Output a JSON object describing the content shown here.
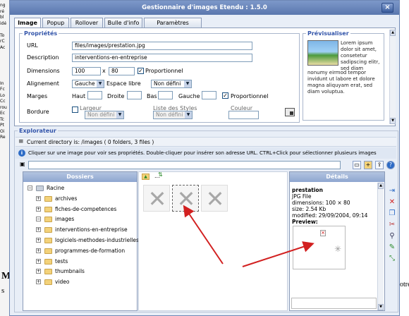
{
  "background": {
    "left_strip": [
      "ng",
      "ré",
      "bl",
      "idé",
      "",
      "To",
      "rC",
      "Ac",
      "",
      "",
      "",
      "",
      "",
      "In",
      "Fc",
      "Lo",
      "Cc",
      "rou",
      "Ec",
      "Tc",
      "Pt",
      "Oi",
      "Re"
    ],
    "text_M": "M",
    "text_s": "s",
    "text_otr": "otre"
  },
  "window": {
    "title": "Gestionnaire d'images Etendu : 1.5.0",
    "close_label": "×"
  },
  "tabs": [
    {
      "label": "Image",
      "active": true
    },
    {
      "label": "Popup"
    },
    {
      "label": "Rollover"
    },
    {
      "label": "Bulle d'info"
    },
    {
      "label": "Paramètres Avancés"
    }
  ],
  "props": {
    "legend": "Propriétés",
    "url_label": "URL",
    "url_value": "files/images/prestation.jpg",
    "description_label": "Description",
    "description_value": "interventions-en-entreprise",
    "dimensions_label": "Dimensions",
    "width_value": "100",
    "times": "x",
    "height_value": "80",
    "proportional_label": "Proportionnel",
    "align_label": "Alignement",
    "align_value": "Gauche",
    "space_label": "Espace libre",
    "space_value": "Non défini",
    "margins_label": "Marges",
    "top_label": "Haut",
    "right_label": "Droite",
    "bottom_label": "Bas",
    "left_label": "Gauche",
    "margins_proportional_label": "Proportionnel",
    "border_label": "Bordure",
    "width_label2": "Largeur",
    "width_select": "Non défini",
    "styles_label": "Liste des Styles",
    "styles_select": "Non défini",
    "color_label": "Couleur"
  },
  "preview": {
    "legend": "Prévisualiser",
    "side_text": "Lorem ipsum dolor sit amet, consetetur sadipscing elitr, sed diam",
    "body_text": "nonumy eirmod tempor invidunt ut labore et dolore magna aliquyam erat, sed diam voluptua."
  },
  "explorer": {
    "legend": "Explorateur",
    "current_dir": "Current directory is: /images ( 0 folders, 3 files )",
    "info": "Cliquer sur une image pour voir ses propriétés. Double-cliquer pour insérer son adresse URL. CTRL+Click pour sélectionner plusieurs images",
    "folders_title": "Dossiers",
    "details_title": "Détails",
    "parent_dots": "...",
    "tree": [
      {
        "label": "Racine",
        "root": true
      },
      {
        "label": "archives"
      },
      {
        "label": "fiches-de-competences"
      },
      {
        "label": "images",
        "expanded": true
      },
      {
        "label": "interventions-en-entreprise"
      },
      {
        "label": "logiciels-methodes-industrielles"
      },
      {
        "label": "programmes-de-formation"
      },
      {
        "label": "tests"
      },
      {
        "label": "thumbnails"
      },
      {
        "label": "video"
      }
    ]
  },
  "details": {
    "name": "prestation",
    "type": "JPG File",
    "dimensions": "dimensions: 100 × 80",
    "size": "size: 2.54 Kb",
    "modified": "modified: 29/09/2004, 09:14",
    "preview_label": "Preview:"
  },
  "colors": {
    "title_bar": "#5a77ae",
    "legend": "#3355aa",
    "arrow": "#d22020",
    "panel_header": "#8ea6d0"
  }
}
